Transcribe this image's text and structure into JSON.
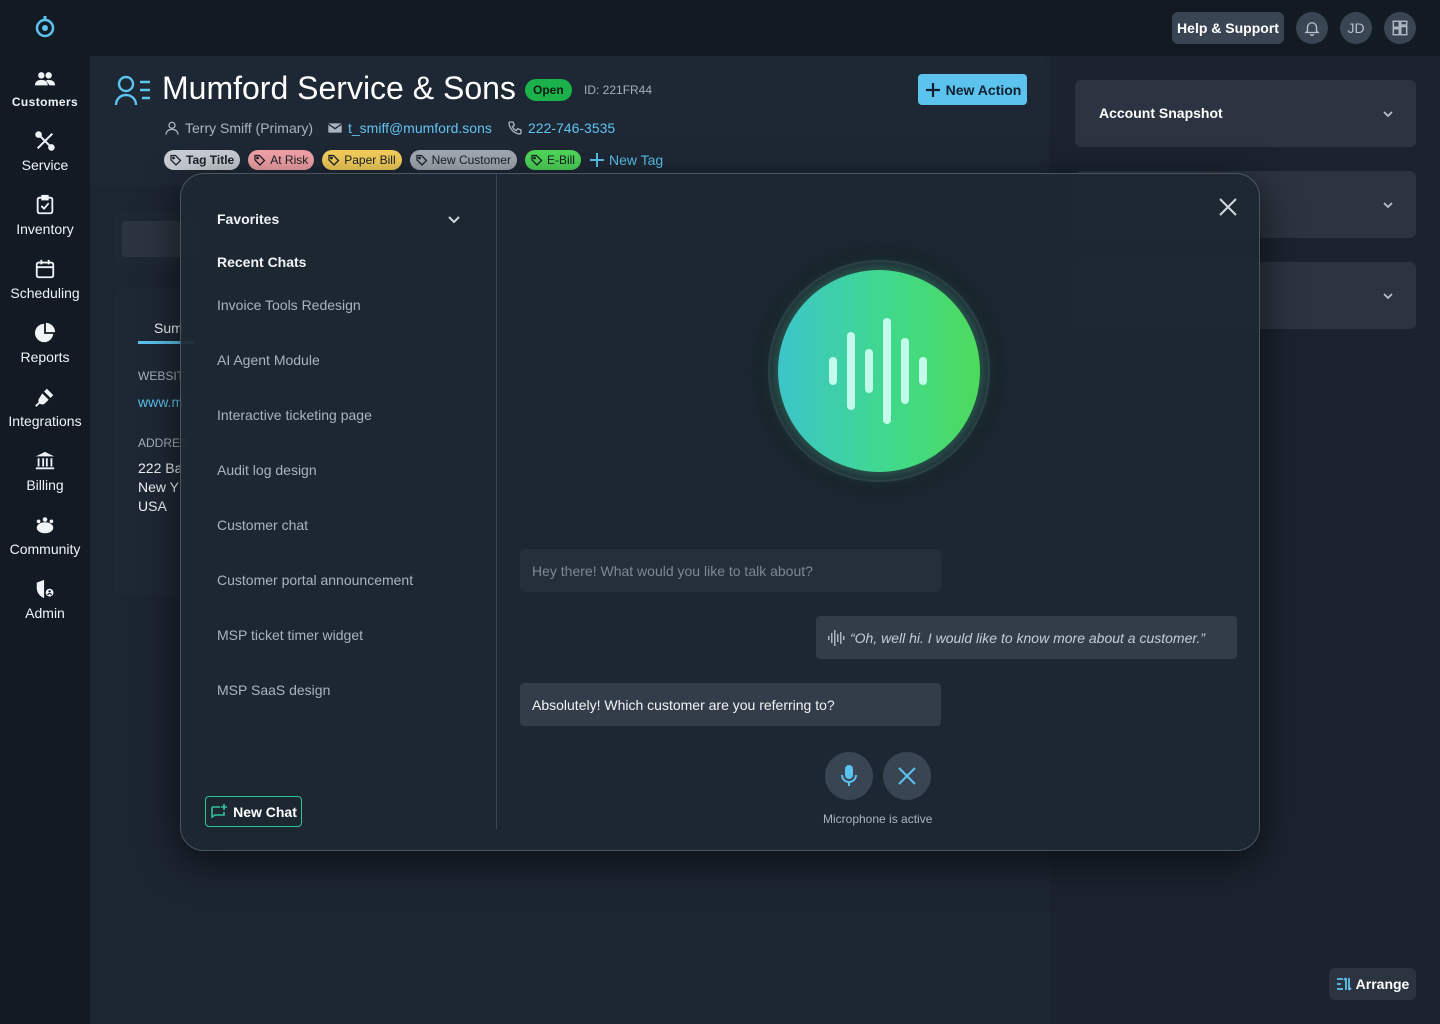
{
  "topbar": {
    "help_label": "Help & Support",
    "avatar_initials": "JD"
  },
  "sidebar": {
    "items": [
      {
        "label": "Customers",
        "icon": "customers-icon",
        "active": true
      },
      {
        "label": "Service",
        "icon": "service-icon"
      },
      {
        "label": "Inventory",
        "icon": "inventory-icon"
      },
      {
        "label": "Scheduling",
        "icon": "calendar-icon"
      },
      {
        "label": "Reports",
        "icon": "pie-chart-icon"
      },
      {
        "label": "Integrations",
        "icon": "plug-icon"
      },
      {
        "label": "Billing",
        "icon": "bank-icon"
      },
      {
        "label": "Community",
        "icon": "community-icon"
      },
      {
        "label": "Admin",
        "icon": "admin-icon"
      }
    ]
  },
  "customer": {
    "name": "Mumford Service & Sons",
    "status": "Open",
    "id": "ID: 221FR44",
    "new_action_label": "New Action",
    "contact_name": "Terry Smiff (Primary)",
    "email": "t_smiff@mumford.sons",
    "phone": "222-746-3535",
    "tags": [
      {
        "label": "Tag Title",
        "color": "#c9ced4"
      },
      {
        "label": "At Risk",
        "color": "#f4a3a8"
      },
      {
        "label": "Paper Bill",
        "color": "#f7d05c"
      },
      {
        "label": "New Customer",
        "color": "#a3aab3"
      },
      {
        "label": "E-Bill",
        "color": "#4fd85a"
      }
    ],
    "new_tag_label": "New Tag"
  },
  "background": {
    "tab_partial": "Sum",
    "website_label": "WEBSIT",
    "website_value": "www.m",
    "address_label": "ADDRES",
    "address_line1": "222 Ba",
    "address_line2": "New Y",
    "address_line3": "USA"
  },
  "right_panel": {
    "snapshot_title": "Account Snapshot",
    "arrange_label": "Arrange"
  },
  "chat_modal": {
    "favorites_label": "Favorites",
    "recent_label": "Recent Chats",
    "recent_chats": [
      "Invoice Tools Redesign",
      "AI Agent Module",
      "Interactive ticketing page",
      "Audit log design",
      "Customer chat",
      "Customer portal announcement",
      "MSP ticket timer widget",
      "MSP SaaS design"
    ],
    "new_chat_label": "New Chat",
    "messages": {
      "assistant_greeting": "Hey there! What would you like to talk about?",
      "user_voice": "“Oh, well hi. I would like to know more about a customer.”",
      "assistant_reply": "Absolutely! Which customer are you referring to?"
    },
    "mic_status": "Microphone is active"
  },
  "colors": {
    "accent": "#5bc3ee",
    "open_badge": "#1bb24b",
    "new_chat_border": "#2ec49a"
  }
}
